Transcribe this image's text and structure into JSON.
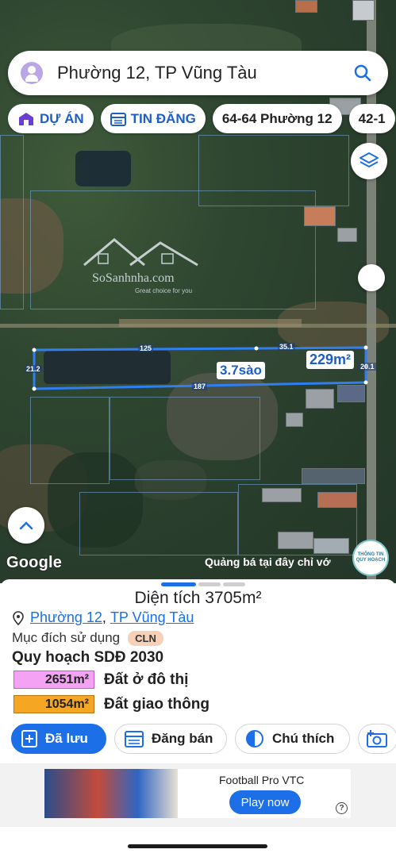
{
  "search": {
    "text": "Phường 12, TP Vũng Tàu"
  },
  "chips": [
    {
      "label": "DỰ ÁN"
    },
    {
      "label": "TIN ĐĂNG"
    },
    {
      "label": "64-64 Phường 12"
    },
    {
      "label": "42-1"
    }
  ],
  "map": {
    "watermark": {
      "brand": "SoSanhnha.com",
      "tagline": "Great choice for you"
    },
    "parcel": {
      "edge_labels": [
        "125",
        "35.1",
        "21.2",
        "187",
        "20.1"
      ],
      "area_sao": "3.7sào",
      "area_m2": "229m²"
    },
    "google": "Google",
    "ad_text": "Quảng bá tại đây chỉ vớ",
    "plan_info_button": "THÔNG TIN QUY HOẠCH"
  },
  "sheet": {
    "area_title": "Diện tích 3705m²",
    "ward": "Phường 12",
    "separator": ", ",
    "city": "TP Vũng Tàu",
    "purpose_label": "Mục đích sử dụng",
    "purpose_code": "CLN",
    "plan_title": "Quy hoạch SDĐ 2030",
    "plan_items": [
      {
        "area": "2651m²",
        "name": "Đất ở đô thị",
        "color": "#f4a3f4"
      },
      {
        "area": "1054m²",
        "name": "Đất giao thông",
        "color": "#f5a623"
      }
    ],
    "actions": [
      {
        "label": "Đã lưu"
      },
      {
        "label": "Đăng bán"
      },
      {
        "label": "Chú thích"
      }
    ]
  },
  "ad": {
    "title": "Football Pro VTC",
    "cta": "Play now",
    "info": "?"
  },
  "colors": {
    "accent": "#1d6fe8",
    "parcel_border": "#2f7ff2"
  }
}
